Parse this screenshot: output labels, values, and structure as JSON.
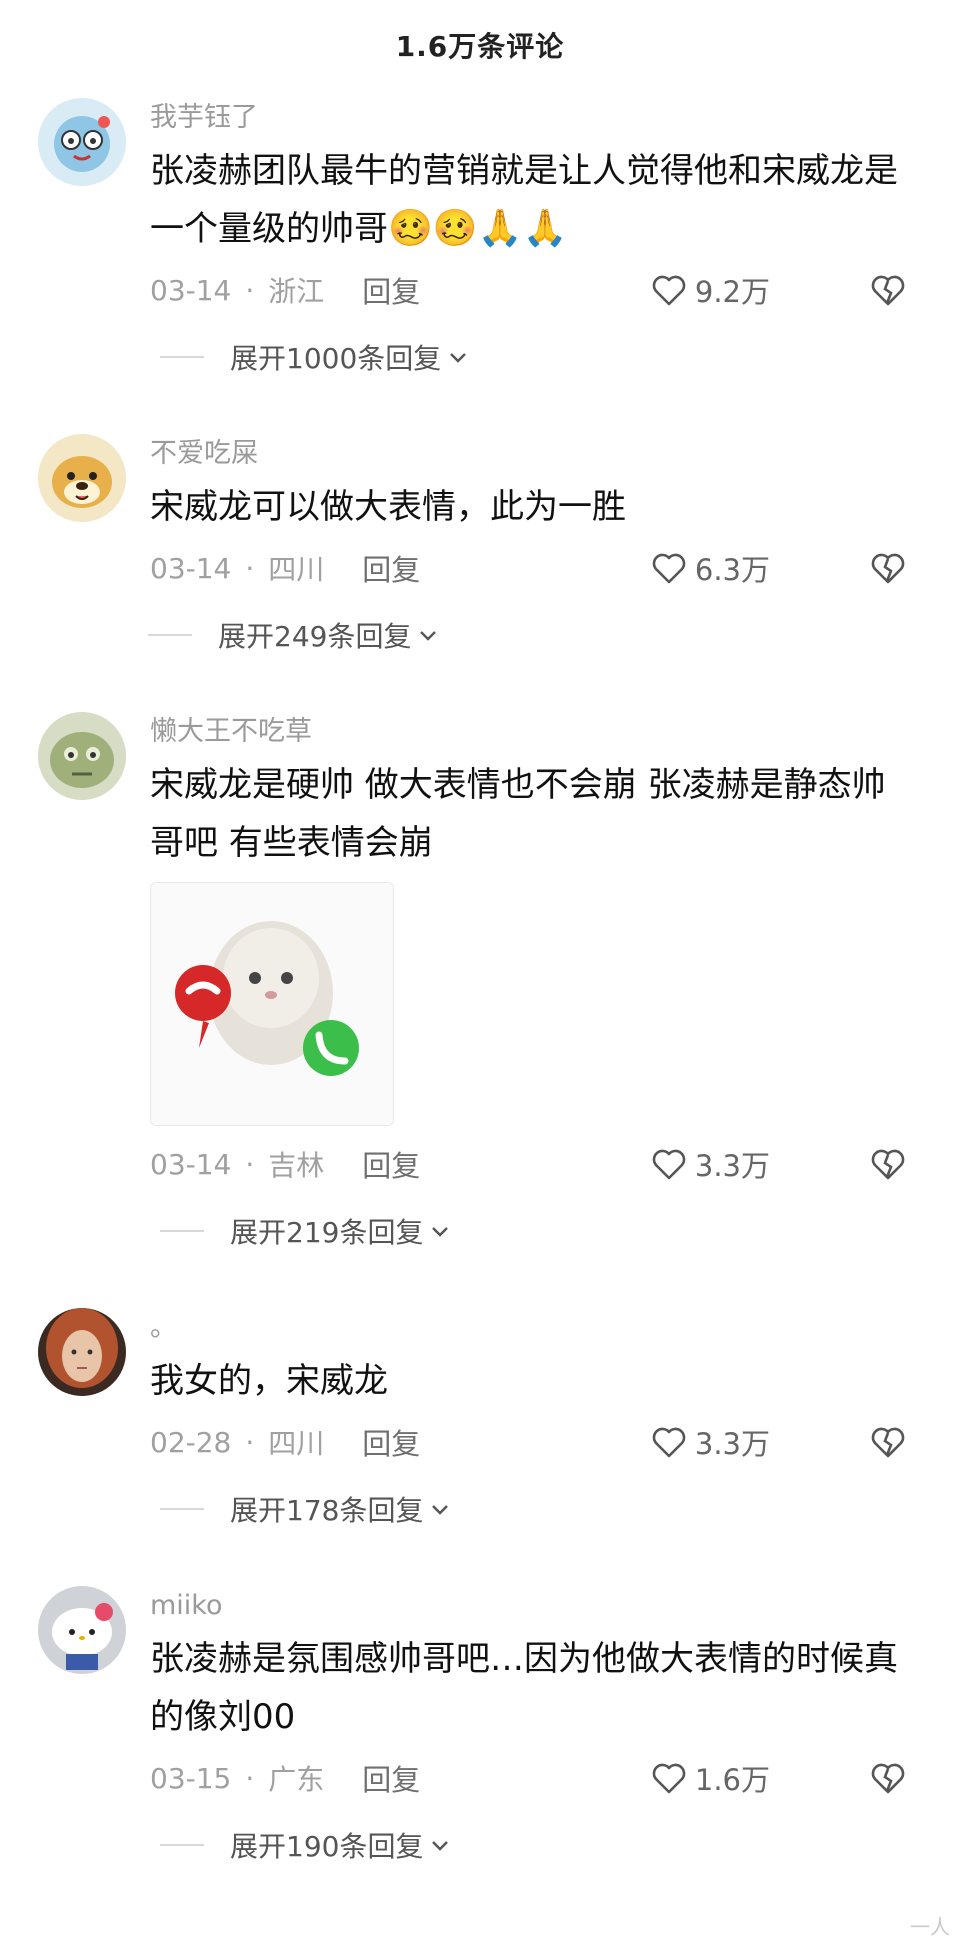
{
  "header": {
    "title": "1.6万条评论"
  },
  "comments": [
    {
      "username": "我芋钰了",
      "content": "张凌赫团队最牛的营销就是让人觉得他和宋威龙是一个量级的帅哥",
      "emojis": "🥴🥴🙏🙏",
      "date": "03-14",
      "dot": "·",
      "location": "浙江",
      "reply": "回复",
      "likes": "9.2万",
      "expand": "展开1000条回复"
    },
    {
      "username": "不爱吃屎",
      "content": "宋威龙可以做大表情，此为一胜",
      "date": "03-14",
      "dot": "·",
      "location": "四川",
      "reply": "回复",
      "likes": "6.3万",
      "expand": "展开249条回复"
    },
    {
      "username": "懒大王不吃草",
      "content": "宋威龙是硬帅 做大表情也不会崩 张凌赫是静态帅哥吧 有些表情会崩",
      "date": "03-14",
      "dot": "·",
      "location": "吉林",
      "reply": "回复",
      "likes": "3.3万",
      "expand": "展开219条回复"
    },
    {
      "username": "。",
      "content": "我女的，宋威龙",
      "date": "02-28",
      "dot": "·",
      "location": "四川",
      "reply": "回复",
      "likes": "3.3万",
      "expand": "展开178条回复"
    },
    {
      "username": "miiko",
      "content": "张凌赫是氛围感帅哥吧…因为他做大表情的时候真的像刘00",
      "date": "03-15",
      "dot": "·",
      "location": "广东",
      "reply": "回复",
      "likes": "1.6万",
      "expand": "展开190条回复"
    }
  ],
  "icons": {
    "like": "heart-outline-icon",
    "dislike": "broken-heart-icon",
    "expand": "chevron-down-icon"
  },
  "watermark": "一人"
}
